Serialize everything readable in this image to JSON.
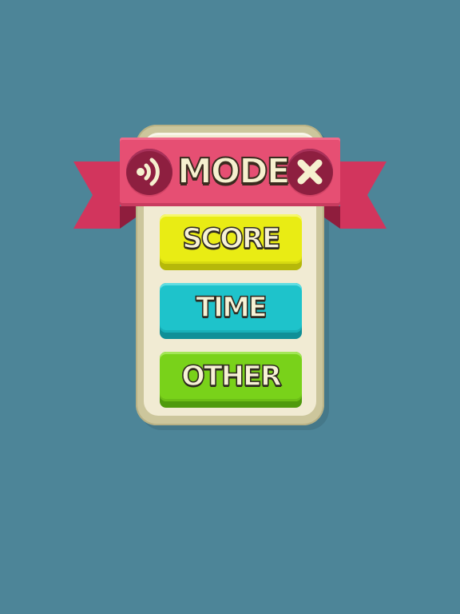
{
  "dialog": {
    "title": "MODE",
    "sound_icon": "sound-icon",
    "close_icon": "close-icon"
  },
  "buttons": [
    {
      "label": "SCORE",
      "color": "#e9ec14"
    },
    {
      "label": "TIME",
      "color": "#1ec3cb"
    },
    {
      "label": "OTHER",
      "color": "#79d21a"
    }
  ],
  "colors": {
    "background": "#4d8598",
    "ribbon": "#e64f73",
    "panel": "#f1ebd3"
  }
}
